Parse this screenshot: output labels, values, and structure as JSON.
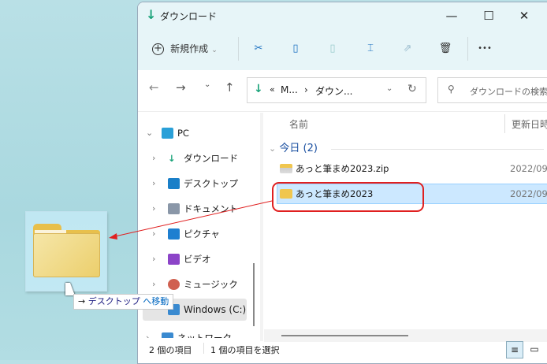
{
  "window": {
    "title": "ダウンロード",
    "minimize": "—",
    "maximize": "☐",
    "close": "✕"
  },
  "toolbar": {
    "new_label": "新規作成",
    "new_chevron": "⌄",
    "more": "•••"
  },
  "address": {
    "path_overflow": "«",
    "path": [
      "M...",
      "ダウン..."
    ],
    "separator": "›",
    "search_placeholder": "ダウンロードの検索"
  },
  "nav_pane": {
    "items": [
      {
        "label": "PC",
        "icon": "pc-icon",
        "color": "#1e90c8"
      },
      {
        "label": "ダウンロード",
        "icon": "download-icon",
        "color": "#1aa37a"
      },
      {
        "label": "デスクトップ",
        "icon": "desktop-icon",
        "color": "#1a7fc8"
      },
      {
        "label": "ドキュメント",
        "icon": "document-icon",
        "color": "#8a97a8"
      },
      {
        "label": "ピクチャ",
        "icon": "pictures-icon",
        "color": "#1e7fd0"
      },
      {
        "label": "ビデオ",
        "icon": "video-icon",
        "color": "#8c44c8"
      },
      {
        "label": "ミュージック",
        "icon": "music-icon",
        "color": "#d06050"
      },
      {
        "label": "Windows (C:)",
        "icon": "drive-icon",
        "color": "#3a8ad0"
      },
      {
        "label": "ネットワーク",
        "icon": "network-icon",
        "color": "#3a8ad0"
      }
    ]
  },
  "content": {
    "columns": {
      "name": "名前",
      "modified": "更新日時"
    },
    "group": {
      "label": "今日 (2)"
    },
    "files": [
      {
        "name": "あっと筆まめ2023.zip",
        "date": "2022/09/",
        "type": "zip-folder"
      },
      {
        "name": "あっと筆まめ2023",
        "date": "2022/09/",
        "type": "folder",
        "selected": true
      }
    ]
  },
  "status": {
    "count": "2 個の項目",
    "selected": "1 個の項目を選択"
  },
  "drag": {
    "tooltip_arrow": "→",
    "tooltip_target": "デスクトップ",
    "tooltip_action": "へ移動"
  },
  "colors": {
    "accent": "#0067c0",
    "selection": "#cce8ff",
    "annotation": "#e02020"
  }
}
